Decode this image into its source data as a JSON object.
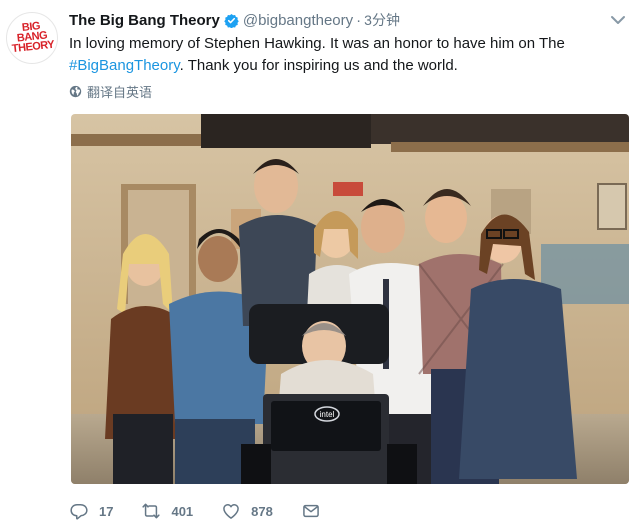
{
  "tweet": {
    "avatar_text": "BIG BANG THEORY",
    "display_name": "The Big Bang Theory",
    "handle": "@bigbangtheory",
    "separator": "·",
    "time": "3分钟",
    "text_part1": "In loving memory of Stephen Hawking. It was an honor to have him on The ",
    "hashtag": "#BigBangTheory",
    "text_part2": ". Thank you for inspiring us and the world.",
    "translate_label": "翻译自英语"
  },
  "photo": {
    "laptop_logo": "intel"
  },
  "actions": {
    "reply_count": "17",
    "retweet_count": "401",
    "like_count": "878"
  },
  "colors": {
    "link": "#1b95e0",
    "secondary_text": "#657786",
    "verified": "#1da1f2",
    "avatar_red": "#d8232a"
  }
}
